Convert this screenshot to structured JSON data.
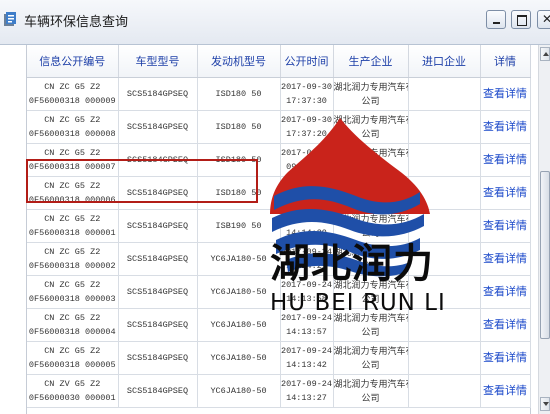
{
  "window": {
    "title": "车辆环保信息查询",
    "controls": {
      "minimize": "minimize",
      "maximize": "maximize",
      "close": "✕"
    }
  },
  "table": {
    "headers": {
      "info_no": "信息公开编号",
      "vehicle_model": "车型型号",
      "engine_model": "发动机型号",
      "publish_time": "公开时间",
      "manufacturer": "生产企业",
      "importer": "进口企业",
      "detail": "详情"
    },
    "rows": [
      {
        "info_no_1": "CN ZC G5 Z2",
        "info_no_2": "0F56000318 000009",
        "vehicle_model": "SCS5184GPSEQ",
        "engine_model": "ISD180 50",
        "date": "2017-09-30",
        "time": "17:37:30",
        "maker_1": "湖北润力专用汽车有限",
        "maker_2": "公司",
        "importer": "",
        "detail": "查看详情"
      },
      {
        "info_no_1": "CN ZC G5 Z2",
        "info_no_2": "0F56000318 000008",
        "vehicle_model": "SCS5184GPSEQ",
        "engine_model": "ISD180 50",
        "date": "2017-09-30",
        "time": "17:37:20",
        "maker_1": "湖北润力专用汽车有限",
        "maker_2": "公司",
        "importer": "",
        "detail": "查看详情"
      },
      {
        "info_no_1": "CN ZC G5 Z2",
        "info_no_2": "0F56000318 000007",
        "vehicle_model": "SCS5184GPSEQ",
        "engine_model": "ISD180 50",
        "date": "2017-09-29",
        "time": "09:22:07",
        "maker_1": "湖北润力专用汽车有限",
        "maker_2": "公司",
        "importer": "",
        "detail": "查看详情"
      },
      {
        "info_no_1": "CN ZC G5 Z2",
        "info_no_2": "0F56000318 000006",
        "vehicle_model": "SCS5184GPSEQ",
        "engine_model": "ISD180 50",
        "date": "2017-09-30",
        "time": "08:55:07",
        "maker_1": "湖北润力专用汽车有限",
        "maker_2": "公司",
        "importer": "",
        "detail": "查看详情"
      },
      {
        "info_no_1": "CN ZC G5 Z2",
        "info_no_2": "0F56000318 000001",
        "vehicle_model": "SCS5184GPSEQ",
        "engine_model": "ISB190 50",
        "date": "2017-09-24",
        "time": "14:14:39",
        "maker_1": "湖北润力专用汽车有限",
        "maker_2": "公司",
        "importer": "",
        "detail": "查看详情"
      },
      {
        "info_no_1": "CN ZC G5 Z2",
        "info_no_2": "0F56000318 000002",
        "vehicle_model": "SCS5184GPSEQ",
        "engine_model": "YC6JA180-50",
        "date": "2017-09-24",
        "time": "14:14:21",
        "maker_1": "湖北润力专用汽车有限",
        "maker_2": "公司",
        "importer": "",
        "detail": "查看详情"
      },
      {
        "info_no_1": "CN ZC G5 Z2",
        "info_no_2": "0F56000318 000003",
        "vehicle_model": "SCS5184GPSEQ",
        "engine_model": "YC6JA180-50",
        "date": "2017-09-24",
        "time": "14:13:58",
        "maker_1": "湖北润力专用汽车有限",
        "maker_2": "公司",
        "importer": "",
        "detail": "查看详情"
      },
      {
        "info_no_1": "CN ZC G5 Z2",
        "info_no_2": "0F56000318 000004",
        "vehicle_model": "SCS5184GPSEQ",
        "engine_model": "YC6JA180-50",
        "date": "2017-09-24",
        "time": "14:13:57",
        "maker_1": "湖北润力专用汽车有限",
        "maker_2": "公司",
        "importer": "",
        "detail": "查看详情"
      },
      {
        "info_no_1": "CN ZC G5 Z2",
        "info_no_2": "0F56000318 000005",
        "vehicle_model": "SCS5184GPSEQ",
        "engine_model": "YC6JA180-50",
        "date": "2017-09-24",
        "time": "14:13:42",
        "maker_1": "湖北润力专用汽车有限",
        "maker_2": "公司",
        "importer": "",
        "detail": "查看详情"
      },
      {
        "info_no_1": "CN ZV G5 Z2",
        "info_no_2": "0F56000030 000001",
        "vehicle_model": "SCS5184GPSEQ",
        "engine_model": "YC6JA180-50",
        "date": "2017-09-24",
        "time": "14:13:27",
        "maker_1": "湖北润力专用汽车有限",
        "maker_2": "公司",
        "importer": "",
        "detail": "查看详情"
      }
    ]
  },
  "watermark": {
    "name_cn": "湖北润力",
    "name_en": "HU BEI RUN LI",
    "colors": {
      "red": "#c9231b",
      "blue": "#1f4fa8"
    }
  },
  "highlight": {
    "row_index": 4,
    "color": "#b21d17"
  }
}
